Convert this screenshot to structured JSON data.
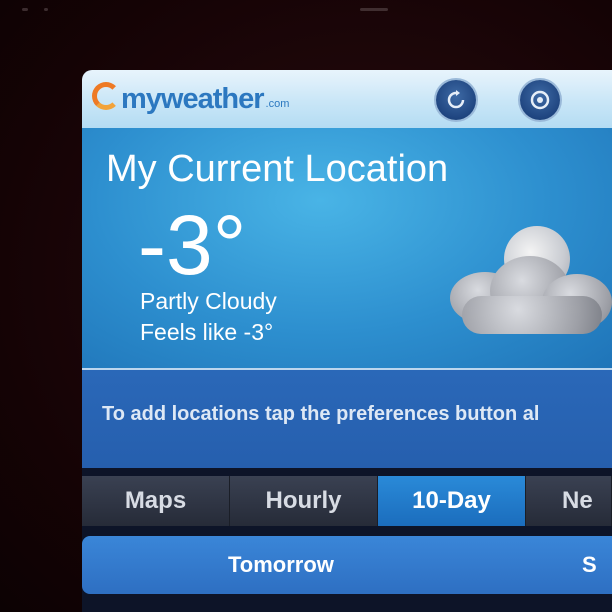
{
  "header": {
    "logo_text": "myweather",
    "logo_suffix": ".com",
    "button_one_icon": "refresh-icon",
    "button_two_icon": "preferences-icon"
  },
  "current": {
    "title": "My Current Location",
    "temperature": "-3°",
    "condition": "Partly Cloudy",
    "feels_like": "Feels like -3°",
    "weather_icon": "partly-cloudy-night-icon"
  },
  "info": {
    "message": "To add locations tap the preferences button al"
  },
  "tabs": [
    {
      "label": "Maps",
      "active": false
    },
    {
      "label": "Hourly",
      "active": false
    },
    {
      "label": "10-Day",
      "active": true
    },
    {
      "label": "Ne",
      "active": false
    }
  ],
  "forecast": {
    "day_one": "Tomorrow",
    "day_two": "S"
  },
  "colors": {
    "accent": "#2d8fcf",
    "brand": "#2c78c0",
    "logo_orange": "#ee7a25"
  }
}
